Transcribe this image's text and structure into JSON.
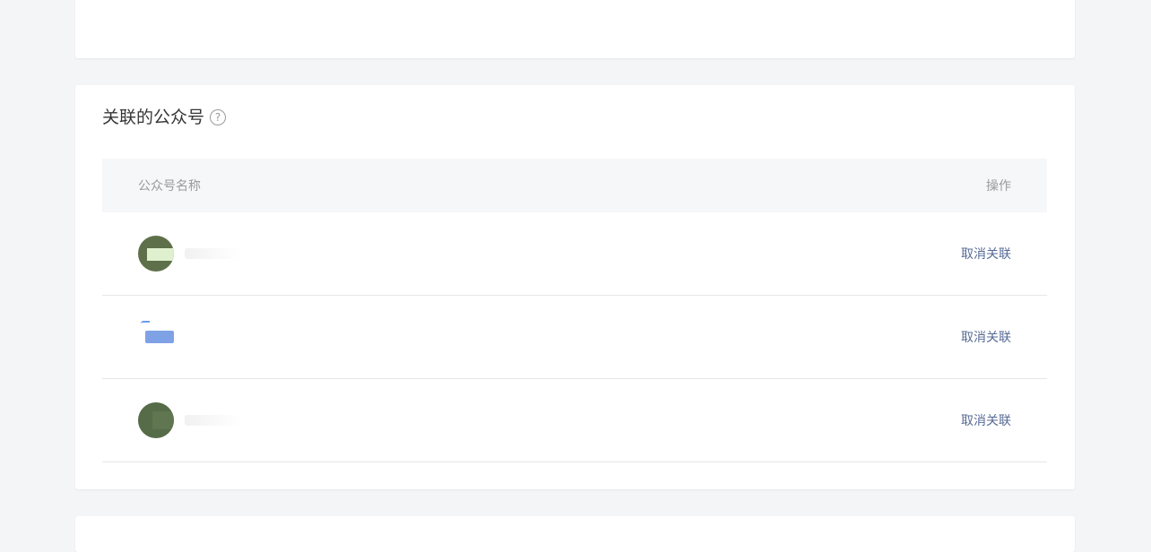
{
  "section": {
    "title": "关联的公众号",
    "help_icon": "question-circle-icon",
    "help_glyph": "?"
  },
  "table": {
    "headers": {
      "name": "公众号名称",
      "action": "操作"
    },
    "rows": [
      {
        "avatar": "green-avatar",
        "action": "取消关联"
      },
      {
        "avatar": "blue-avatar",
        "action": "取消关联"
      },
      {
        "avatar": "dark-green-avatar",
        "action": "取消关联"
      }
    ]
  },
  "colors": {
    "link": "#576b95",
    "background": "#f4f5f7",
    "header_bg": "#f6f7f9"
  }
}
